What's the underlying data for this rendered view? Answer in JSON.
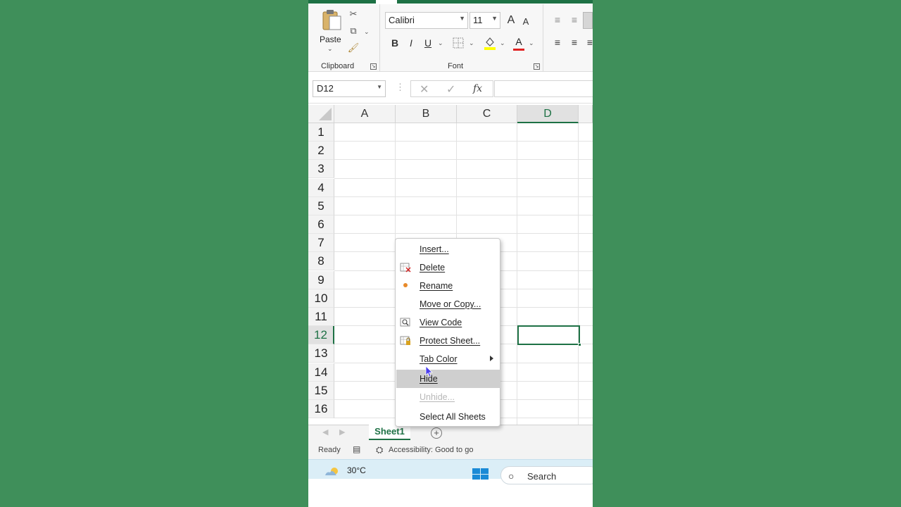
{
  "colors": {
    "accent": "#1e7145",
    "background": "#3f8f5a",
    "menu_hover": "#cfcfcf"
  },
  "ribbon": {
    "clipboard": {
      "paste_label": "Paste",
      "group_label": "Clipboard"
    },
    "font": {
      "font_name": "Calibri",
      "font_size": "11",
      "bold": "B",
      "italic": "I",
      "underline": "U",
      "grow": "A",
      "shrink": "A",
      "font_color_glyph": "A",
      "group_label": "Font"
    }
  },
  "formula_bar": {
    "name_box": "D12",
    "fx_label": "fx",
    "formula_value": ""
  },
  "grid": {
    "columns": [
      "A",
      "B",
      "C",
      "D"
    ],
    "selected_column": "D",
    "rows": [
      "1",
      "2",
      "3",
      "4",
      "5",
      "6",
      "7",
      "8",
      "9",
      "10",
      "11",
      "12",
      "13",
      "14",
      "15",
      "16"
    ],
    "selected_row": "12",
    "active_cell": "D12"
  },
  "sheets": {
    "tabs": [
      "Sheet1"
    ],
    "active": "Sheet1"
  },
  "status_bar": {
    "ready": "Ready",
    "accessibility": "Accessibility: Good to go"
  },
  "taskbar": {
    "weather_temp": "30°C",
    "search_label": "Search"
  },
  "context_menu": {
    "items": [
      {
        "label": "Insert...",
        "icon": "",
        "enabled": true
      },
      {
        "label": "Delete",
        "icon": "delete-sheet-icon",
        "enabled": true
      },
      {
        "label": "Rename",
        "icon": "rename-icon",
        "enabled": true
      },
      {
        "label": "Move or Copy...",
        "icon": "",
        "enabled": true
      },
      {
        "label": "View Code",
        "icon": "view-code-icon",
        "enabled": true
      },
      {
        "label": "Protect Sheet...",
        "icon": "protect-sheet-icon",
        "enabled": true
      },
      {
        "label": "Tab Color",
        "icon": "",
        "enabled": true,
        "submenu": true
      },
      {
        "label": "Hide",
        "icon": "",
        "enabled": true,
        "hovered": true
      },
      {
        "label": "Unhide...",
        "icon": "",
        "enabled": false
      },
      {
        "label": "Select All Sheets",
        "icon": "",
        "enabled": true
      }
    ]
  }
}
